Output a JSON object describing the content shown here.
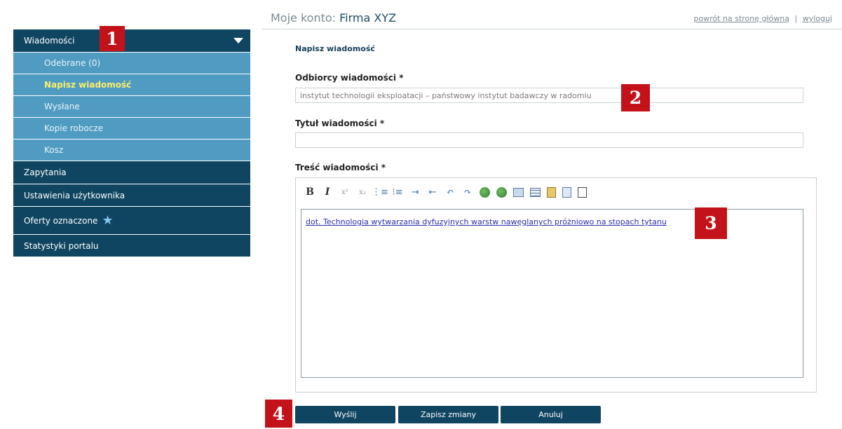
{
  "header": {
    "title_prefix": "Moje konto:",
    "company": "Firma XYZ",
    "link_home": "powrót na stronę główną",
    "separator": "|",
    "link_logout": "wyloguj"
  },
  "sidebar": {
    "items": [
      {
        "label": "Wiadomości"
      },
      {
        "label": "Odebrane (0)"
      },
      {
        "label": "Napisz wiadomość"
      },
      {
        "label": "Wysłane"
      },
      {
        "label": "Kopie robocze"
      },
      {
        "label": "Kosz"
      },
      {
        "label": "Zapytania"
      },
      {
        "label": "Ustawienia użytkownika"
      },
      {
        "label": "Oferty oznaczone"
      },
      {
        "label": "Statystyki portalu"
      }
    ]
  },
  "form": {
    "title": "Napisz wiadomość",
    "recipients_label": "Odbiorcy wiadomości *",
    "recipients_value": "instytut technologii eksploatacji – państwowy instytut badawczy w radomiu",
    "subject_label": "Tytuł wiadomości *",
    "subject_value": "",
    "body_label": "Treść wiadomości *",
    "body_text": "dot. Technologia wytwarzania dyfuzyjnych warstw nawęglanych próżniowo na stopach tytanu"
  },
  "toolbar": {
    "bold": "B",
    "italic": "I",
    "superscript": "x²",
    "subscript": "x₂",
    "ordered_list": "⋮≡",
    "unordered_list": "⁝≡",
    "indent": "⇥",
    "outdent": "⇤",
    "undo": "↶",
    "redo": "↷"
  },
  "buttons": {
    "send": "Wyślij",
    "save": "Zapisz zmiany",
    "cancel": "Anuluj"
  },
  "markers": {
    "m1": "1",
    "m2": "2",
    "m3": "3",
    "m4": "4"
  },
  "colors": {
    "nav_dark": "#0f4561",
    "nav_light": "#4f9bc1",
    "active_text": "#fdf06a",
    "marker_red": "#c4121b"
  }
}
